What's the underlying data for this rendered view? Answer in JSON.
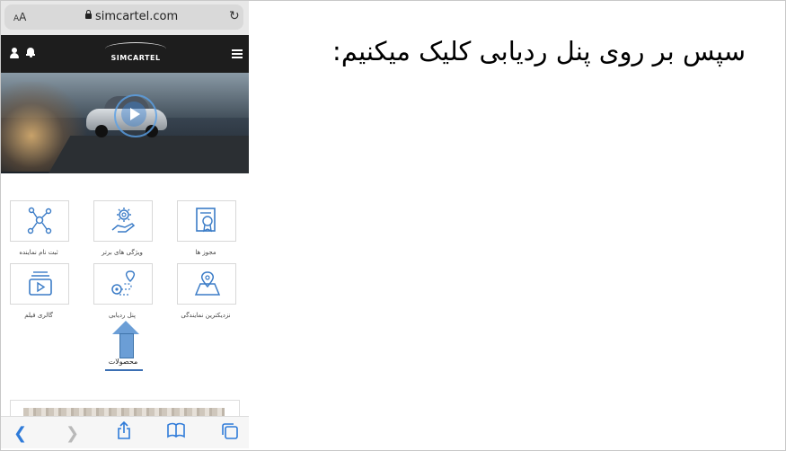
{
  "browser": {
    "text_size_label": "AA",
    "url": "simcartel.com"
  },
  "site": {
    "logo_text": "SIMCARTEL"
  },
  "menu_tiles": [
    {
      "label": "مجوز ها",
      "icon": "certificate-icon"
    },
    {
      "label": "ویژگی های برتر",
      "icon": "hand-gear-icon"
    },
    {
      "label": "ثبت نام نماینده",
      "icon": "network-icon"
    },
    {
      "label": "نزدیکترین نمایندگی",
      "icon": "map-pin-icon"
    },
    {
      "label": "پنل ردیابی",
      "icon": "route-tracking-icon"
    },
    {
      "label": "گالری فیلم",
      "icon": "video-gallery-icon"
    }
  ],
  "products_label": "محصولات",
  "caption": "سپس بر روی پنل ردیابی کلیک میکنیم:",
  "colors": {
    "accent": "#3b6fb3",
    "arrow": "#6b9ed6",
    "navbar": "#1d1d1d"
  }
}
